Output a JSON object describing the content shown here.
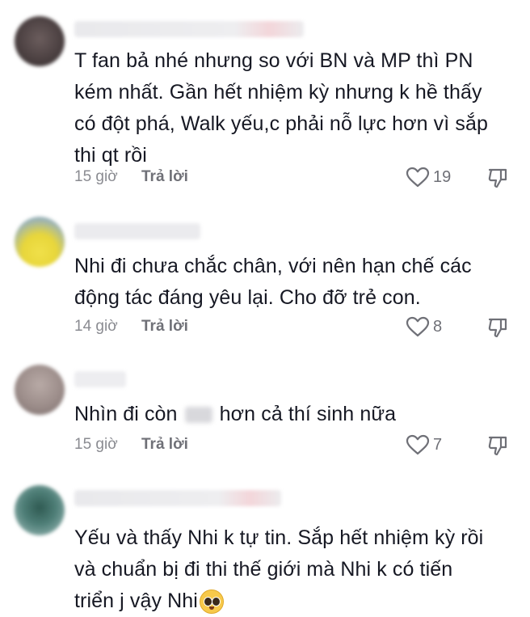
{
  "comments": [
    {
      "text_lines": [
        "T fan bả nhé nhưng so với BN và MP thì PN",
        "kém nhất. Gần hết nhiệm kỳ nhưng k hề thấy",
        "có đột phá, Walk yếu,c phải nỗ lực hơn vì sắp",
        "thi qt rồi"
      ],
      "time": "15 giờ",
      "reply_label": "Trả lời",
      "likes": "19"
    },
    {
      "text_lines": [
        "Nhi đi chưa chắc chân, với nên hạn chế các",
        "động tác đáng yêu lại. Cho đỡ trẻ con."
      ],
      "time": "14 giờ",
      "reply_label": "Trả lời",
      "likes": "8"
    },
    {
      "text_before": "Nhìn đi còn",
      "text_after": "hơn cả thí sinh nữa",
      "time": "15 giờ",
      "reply_label": "Trả lời",
      "likes": "7"
    },
    {
      "text_lines": [
        "Yếu và thấy Nhi k tự tin. Sắp hết nhiệm kỳ rồi",
        "và chuẩn bị đi thi thế giới mà Nhi k có tiến",
        "triển j vậy Nhi"
      ]
    }
  ],
  "icons": {
    "like": "heart-outline-icon",
    "dislike": "thumbs-down-outline-icon",
    "emoji": "pleading-face-emoji"
  },
  "colors": {
    "text": "#161823",
    "meta": "#8a8b91",
    "icon": "#6f7077"
  }
}
